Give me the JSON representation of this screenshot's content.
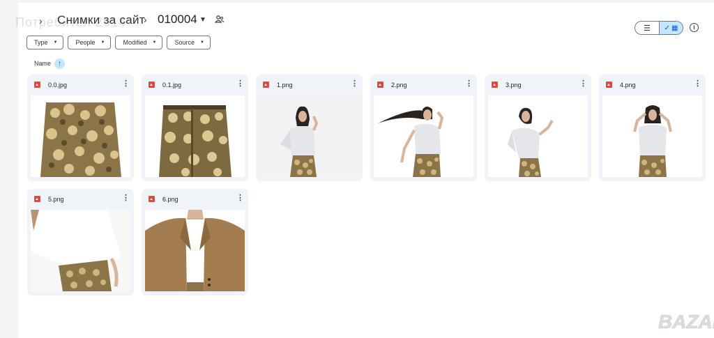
{
  "header": {
    "watermark": "Потребител 2914",
    "breadcrumb_root": "Снимки за сайт",
    "breadcrumb_current": "010004"
  },
  "view": {
    "list_icon": "list-icon",
    "grid_icon": "grid-icon",
    "selected": "grid"
  },
  "filters": [
    {
      "label": "Type"
    },
    {
      "label": "People"
    },
    {
      "label": "Modified"
    },
    {
      "label": "Source"
    }
  ],
  "sort": {
    "label": "Name",
    "direction": "ascending"
  },
  "files": [
    {
      "name": "0.0.jpg",
      "icon": "image-file-icon",
      "thumb": "sequin-skirt"
    },
    {
      "name": "0.1.jpg",
      "icon": "image-file-icon",
      "thumb": "sequin-skirt-back"
    },
    {
      "name": "1.png",
      "icon": "image-file-icon",
      "thumb": "woman-hand-on-hip"
    },
    {
      "name": "2.png",
      "icon": "image-file-icon",
      "thumb": "woman-hair-flying"
    },
    {
      "name": "3.png",
      "icon": "image-file-icon",
      "thumb": "woman-dancing"
    },
    {
      "name": "4.png",
      "icon": "image-file-icon",
      "thumb": "woman-hands-on-head"
    },
    {
      "name": "5.png",
      "icon": "image-file-icon",
      "thumb": "shirt-and-skirt-closeup"
    },
    {
      "name": "6.png",
      "icon": "image-file-icon",
      "thumb": "camel-blazer"
    }
  ],
  "logo": {
    "text": "BAZAR",
    "color": "#d9dde1"
  },
  "colors": {
    "accent": "#0b57d0",
    "selected_bg": "#c2e7ff",
    "card_bg": "#f0f4f9",
    "file_icon": "#ea4335"
  }
}
